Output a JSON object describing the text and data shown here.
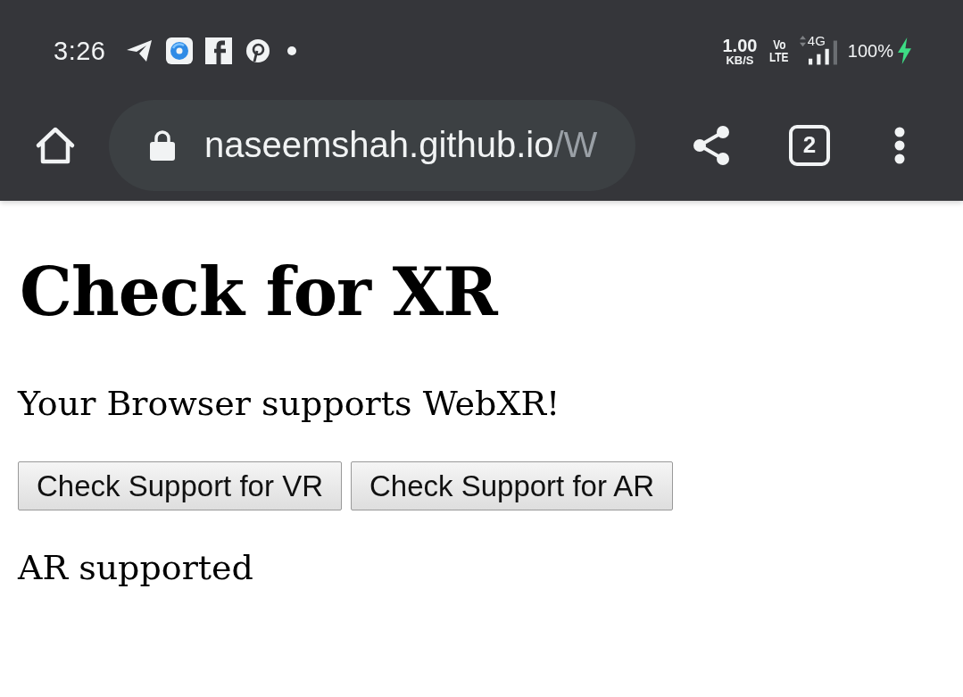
{
  "status_bar": {
    "time": "3:26",
    "network_speed": "1.00",
    "network_speed_unit": "KB/S",
    "volte_top": "Vo",
    "volte_bottom": "LTE",
    "network_type": "4G",
    "battery_percent": "100%",
    "charging": true
  },
  "toolbar": {
    "url_host": "naseemshah.github.io",
    "url_path": "/W",
    "tab_count": "2"
  },
  "page": {
    "heading": "Check for XR",
    "message": "Your Browser supports WebXR!",
    "buttons": [
      "Check Support for VR",
      "Check Support for AR"
    ],
    "result": "AR supported"
  }
}
